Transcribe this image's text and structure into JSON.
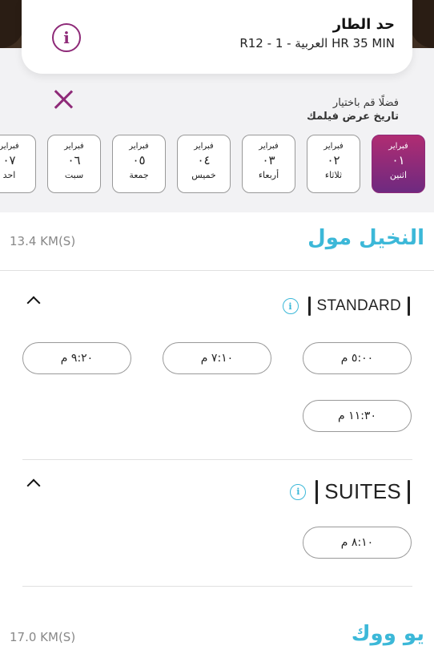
{
  "movie": {
    "title": "حد الطار",
    "meta": "R12 - العربية - 1 HR 35 MIN",
    "info_icon": "info-icon"
  },
  "date_prompt": {
    "line1": "فضلًا قم باختيار",
    "line2": "تاريخ عرض فيلمك"
  },
  "dates": [
    {
      "month": "فبراير",
      "day": "٠١",
      "weekday": "اثنين",
      "selected": true
    },
    {
      "month": "فبراير",
      "day": "٠٢",
      "weekday": "ثلاثاء",
      "selected": false
    },
    {
      "month": "فبراير",
      "day": "٠٣",
      "weekday": "أربعاء",
      "selected": false
    },
    {
      "month": "فبراير",
      "day": "٠٤",
      "weekday": "خميس",
      "selected": false
    },
    {
      "month": "فبراير",
      "day": "٠٥",
      "weekday": "جمعة",
      "selected": false
    },
    {
      "month": "فبراير",
      "day": "٠٦",
      "weekday": "سبت",
      "selected": false
    },
    {
      "month": "فبراير",
      "day": "٠٧",
      "weekday": "احد",
      "selected": false
    }
  ],
  "cinemas": [
    {
      "name": "النخيل مول",
      "distance": "13.4 KM(S)",
      "experiences": [
        {
          "label": "STANDARD",
          "times": [
            "٥:٠٠ م",
            "٧:١٠ م",
            "٩:٢٠ م",
            "١١:٣٠ م"
          ]
        },
        {
          "label": "SUITES",
          "times": [
            "٨:١٠ م"
          ]
        }
      ]
    },
    {
      "name": "يو ووك",
      "distance": "17.0 KM(S)"
    }
  ],
  "colors": {
    "brand": "#8e2a78",
    "accent": "#3cb8d8"
  }
}
